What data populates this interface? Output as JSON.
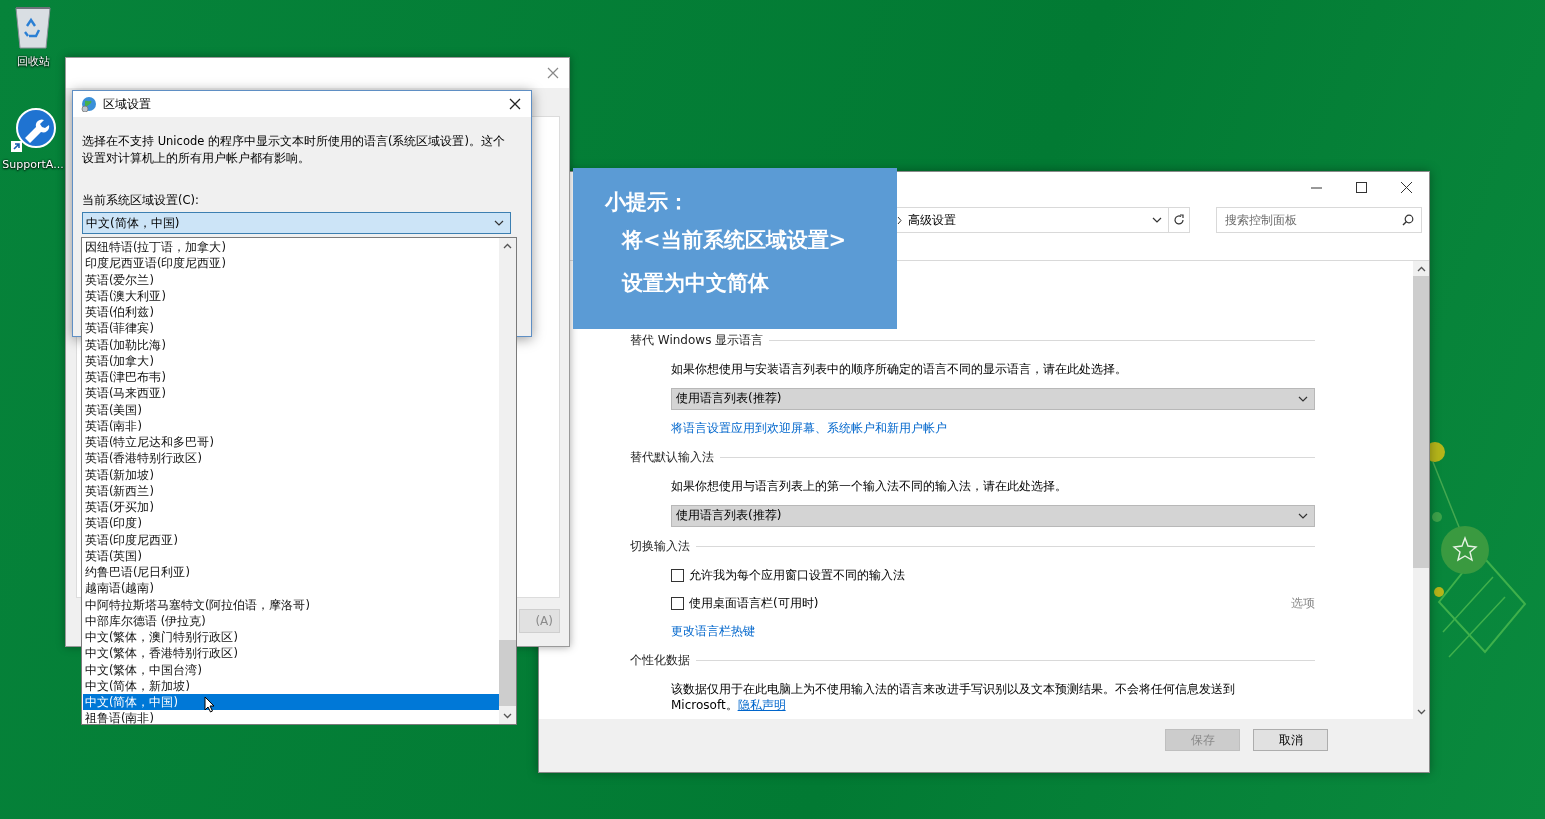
{
  "desktop": {
    "icons": [
      {
        "label": "回收站",
        "kind": "recycle"
      },
      {
        "label": "SupportA...",
        "kind": "shortcut"
      }
    ]
  },
  "back_window": {
    "button_label": "(A)"
  },
  "region_dialog": {
    "title": "区域设置",
    "description": "选择在不支持 Unicode 的程序中显示文本时所使用的语言(系统区域设置)。这个设置对计算机上的所有用户帐户都有影响。",
    "field_label": "当前系统区域设置(C):",
    "value": "中文(简体，中国)",
    "expanded": true,
    "options": [
      {
        "label": "因纽特语(拉丁语，加拿大)",
        "selected": false
      },
      {
        "label": "印度尼西亚语(印度尼西亚)",
        "selected": false
      },
      {
        "label": "英语(爱尔兰)",
        "selected": false
      },
      {
        "label": "英语(澳大利亚)",
        "selected": false
      },
      {
        "label": "英语(伯利兹)",
        "selected": false
      },
      {
        "label": "英语(菲律宾)",
        "selected": false
      },
      {
        "label": "英语(加勒比海)",
        "selected": false
      },
      {
        "label": "英语(加拿大)",
        "selected": false
      },
      {
        "label": "英语(津巴布韦)",
        "selected": false
      },
      {
        "label": "英语(马来西亚)",
        "selected": false
      },
      {
        "label": "英语(美国)",
        "selected": false
      },
      {
        "label": "英语(南非)",
        "selected": false
      },
      {
        "label": "英语(特立尼达和多巴哥)",
        "selected": false
      },
      {
        "label": "英语(香港特别行政区)",
        "selected": false
      },
      {
        "label": "英语(新加坡)",
        "selected": false
      },
      {
        "label": "英语(新西兰)",
        "selected": false
      },
      {
        "label": "英语(牙买加)",
        "selected": false
      },
      {
        "label": "英语(印度)",
        "selected": false
      },
      {
        "label": "英语(印度尼西亚)",
        "selected": false
      },
      {
        "label": "英语(英国)",
        "selected": false
      },
      {
        "label": "约鲁巴语(尼日利亚)",
        "selected": false
      },
      {
        "label": "越南语(越南)",
        "selected": false
      },
      {
        "label": "中阿特拉斯塔马塞特文(阿拉伯语，摩洛哥)",
        "selected": false
      },
      {
        "label": "中部库尔德语 (伊拉克)",
        "selected": false
      },
      {
        "label": "中文(繁体，澳门特别行政区)",
        "selected": false
      },
      {
        "label": "中文(繁体，香港特别行政区)",
        "selected": false
      },
      {
        "label": "中文(繁体，中国台湾)",
        "selected": false
      },
      {
        "label": "中文(简体，新加坡)",
        "selected": false
      },
      {
        "label": "中文(简体，中国)",
        "selected": true
      },
      {
        "label": "祖鲁语(南非)",
        "selected": false
      }
    ]
  },
  "tip": {
    "title": "小提示：",
    "lines": [
      "将<当前系统区域设置>",
      "设置为中文简体"
    ]
  },
  "advanced_window": {
    "breadcrumb": "高级设置",
    "search": {
      "placeholder": "搜索控制面板"
    },
    "sections": [
      {
        "title": "替代 Windows 显示语言",
        "items": [
          {
            "kind": "description",
            "text": "如果你想使用与安装语言列表中的顺序所确定的语言不同的显示语言，请在此处选择。"
          },
          {
            "kind": "dropdown",
            "value": "使用语言列表(推荐)"
          },
          {
            "kind": "link",
            "text": "将语言设置应用到欢迎屏幕、系统帐户和新用户帐户"
          }
        ]
      },
      {
        "title": "替代默认输入法",
        "items": [
          {
            "kind": "description",
            "text": "如果你想使用与语言列表上的第一个输入法不同的输入法，请在此处选择。"
          },
          {
            "kind": "dropdown",
            "value": "使用语言列表(推荐)"
          }
        ]
      },
      {
        "title": "切换输入法",
        "items": [
          {
            "kind": "checkbox",
            "text": "允许我为每个应用窗口设置不同的输入法",
            "checked": false
          },
          {
            "kind": "checkbox",
            "text": "使用桌面语言栏(可用时)",
            "checked": false,
            "option": "选项"
          },
          {
            "kind": "link",
            "text": "更改语言栏热键"
          }
        ]
      },
      {
        "title": "个性化数据",
        "items": [
          {
            "kind": "paragraph",
            "text": "该数据仅用于在此电脑上为不使用输入法的语言来改进手写识别以及文本预测结果。不会将任何信息发送到 Microsoft。",
            "link": "隐私声明"
          }
        ]
      }
    ],
    "buttons": [
      {
        "label": "保存",
        "disabled": true
      },
      {
        "label": "取消",
        "disabled": false
      }
    ]
  }
}
